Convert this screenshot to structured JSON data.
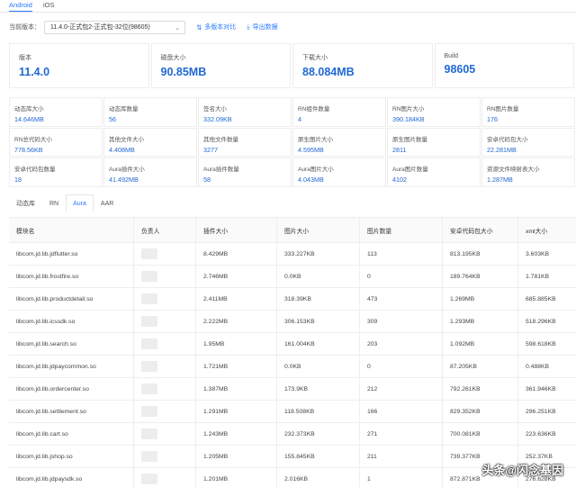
{
  "os_tabs": [
    "Android",
    "iOS"
  ],
  "version": {
    "label": "当前版本：",
    "selected": "11.4.0-正式包2-正式包-32位(98605)",
    "compare_label": "多版本对比",
    "export_label": "导出数据"
  },
  "summary": [
    {
      "label": "版本",
      "value": "11.4.0"
    },
    {
      "label": "磁盘大小",
      "value": "90.85MB"
    },
    {
      "label": "下载大小",
      "value": "88.084MB"
    },
    {
      "label": "Build",
      "value": "98605"
    }
  ],
  "metrics": [
    {
      "label": "动态库大小",
      "value": "14.646MB"
    },
    {
      "label": "动态库数量",
      "value": "56"
    },
    {
      "label": "签名大小",
      "value": "332.09KB"
    },
    {
      "label": "RN组件数量",
      "value": "4"
    },
    {
      "label": "RN图片大小",
      "value": "390.184KB"
    },
    {
      "label": "RN图片数量",
      "value": "176"
    },
    {
      "label": "RN总代码大小",
      "value": "778.56KB"
    },
    {
      "label": "其他文件大小",
      "value": "4.408MB"
    },
    {
      "label": "其他文件数量",
      "value": "3277"
    },
    {
      "label": "原生图片大小",
      "value": "4.595MB"
    },
    {
      "label": "原生图片数量",
      "value": "2811"
    },
    {
      "label": "安卓代码包大小",
      "value": "22.281MB"
    },
    {
      "label": "安卓代码包数量",
      "value": "18"
    },
    {
      "label": "Aura插件大小",
      "value": "41.492MB"
    },
    {
      "label": "Aura插件数量",
      "value": "58"
    },
    {
      "label": "Aura图片大小",
      "value": "4.043MB"
    },
    {
      "label": "Aura图片数量",
      "value": "4102"
    },
    {
      "label": "资源文件映射表大小",
      "value": "1.287MB"
    }
  ],
  "sub_tabs": [
    "动态库",
    "RN",
    "Aura",
    "AAR"
  ],
  "table": {
    "headers": [
      "模块名",
      "负责人",
      "插件大小",
      "图片大小",
      "图片数量",
      "安卓代码包大小",
      "xml大小"
    ],
    "rows": [
      [
        "libcom.jd.lib.jdflutter.so",
        "",
        "8.429MB",
        "333.227KB",
        "113",
        "813.195KB",
        "3.603KB"
      ],
      [
        "libcom.jd.lib.frostfire.so",
        "",
        "2.746MB",
        "0.0KB",
        "0",
        "189.764KB",
        "1.781KB"
      ],
      [
        "libcom.jd.lib.productdetail.so",
        "",
        "2.411MB",
        "318.39KB",
        "473",
        "1.269MB",
        "685.885KB"
      ],
      [
        "libcom.jd.lib.icssdk.so",
        "",
        "2.222MB",
        "306.153KB",
        "309",
        "1.293MB",
        "518.296KB"
      ],
      [
        "libcom.jd.lib.search.so",
        "",
        "1.95MB",
        "161.004KB",
        "203",
        "1.092MB",
        "598.618KB"
      ],
      [
        "libcom.jd.lib.jdpaycommon.so",
        "",
        "1.721MB",
        "0.0KB",
        "0",
        "87.205KB",
        "0.488KB"
      ],
      [
        "libcom.jd.lib.ordercenter.so",
        "",
        "1.387MB",
        "173.9KB",
        "212",
        "792.261KB",
        "361.946KB"
      ],
      [
        "libcom.jd.lib.settlement.so",
        "",
        "1.291MB",
        "118.508KB",
        "166",
        "829.352KB",
        "296.251KB"
      ],
      [
        "libcom.jd.lib.cart.so",
        "",
        "1.243MB",
        "232.373KB",
        "271",
        "700.081KB",
        "223.636KB"
      ],
      [
        "libcom.jd.lib.jshop.so",
        "",
        "1.205MB",
        "155.845KB",
        "211",
        "739.377KB",
        "252.37KB"
      ],
      [
        "libcom.jd.lib.jdpaysdk.so",
        "",
        "1.201MB",
        "2.016KB",
        "1",
        "872.871KB",
        "276.628KB"
      ]
    ]
  },
  "watermark": "头条@闪念基因"
}
